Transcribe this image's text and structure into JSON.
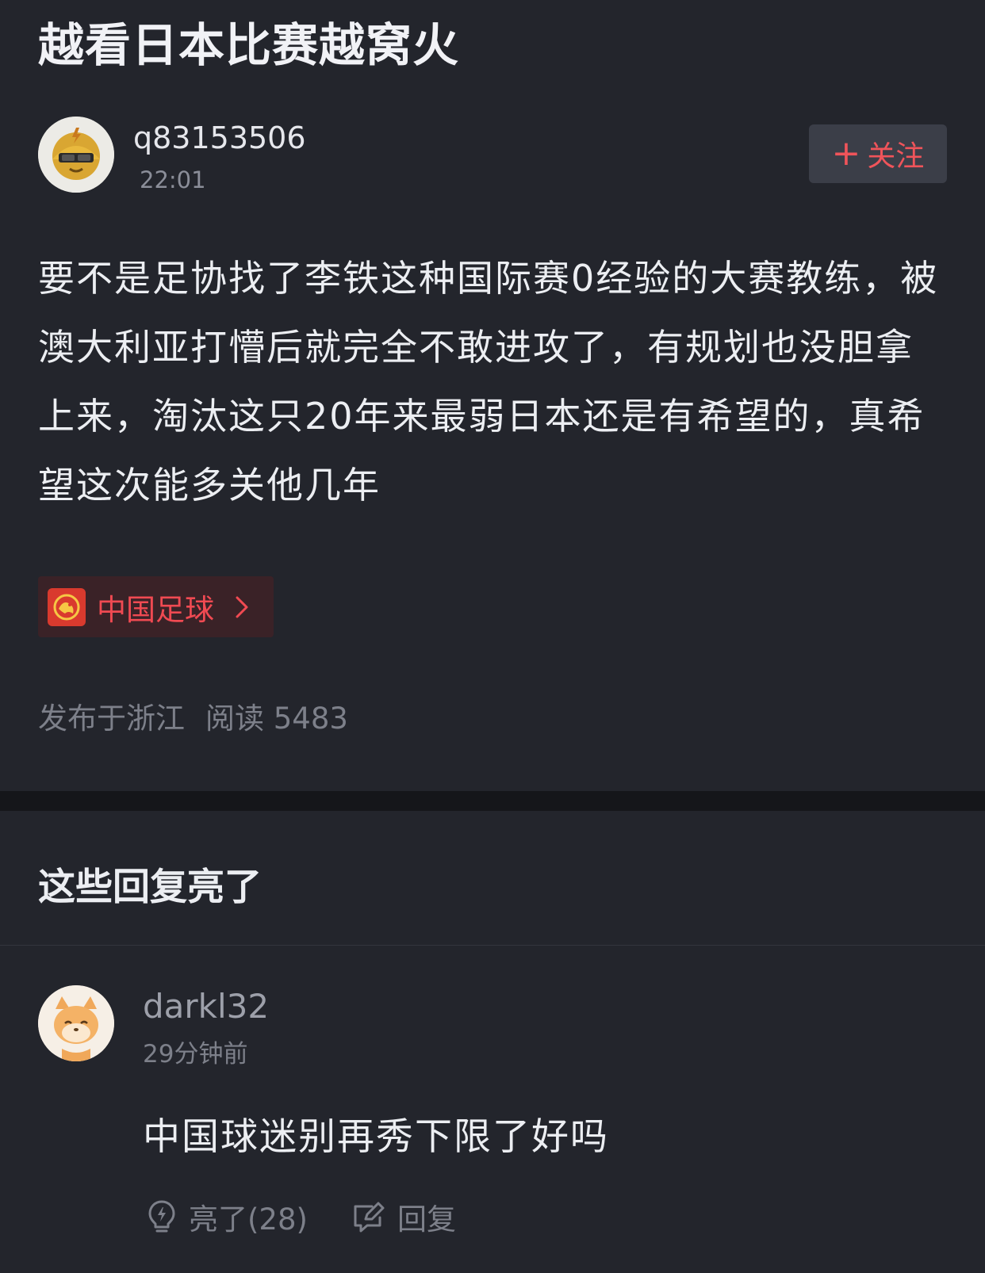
{
  "post": {
    "title": "越看日本比赛越窝火",
    "author": {
      "username": "q83153506",
      "time": "22:01"
    },
    "follow_label": "关注",
    "body": "要不是足协找了李铁这种国际赛0经验的大赛教练，被澳大利亚打懵后就完全不敢进攻了，有规划也没胆拿上来，淘汰这只20年来最弱日本还是有希望的，真希望这次能多关他几年",
    "topic": {
      "label": "中国足球"
    },
    "meta": {
      "location": "发布于浙江",
      "reads_label": "阅读 5483"
    }
  },
  "highlights": {
    "title": "这些回复亮了",
    "comments": [
      {
        "username": "darkl32",
        "time": "29分钟前",
        "text": "中国球迷别再秀下限了好吗",
        "like_label": "亮了(28)",
        "reply_label": "回复"
      }
    ]
  },
  "colors": {
    "background": "#23252c",
    "accent_red": "#f0545a",
    "muted_text": "#7d808a"
  },
  "icons": [
    "plus-icon",
    "chevron-right-icon",
    "lightbulb-icon",
    "reply-icon",
    "dragon-icon"
  ]
}
